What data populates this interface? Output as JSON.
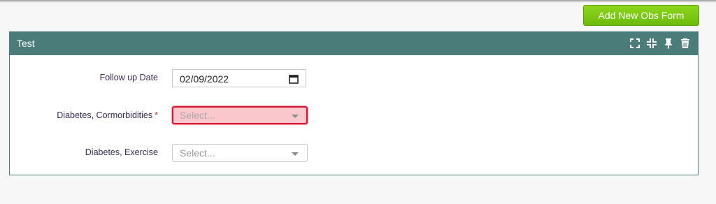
{
  "toolbar": {
    "add_label": "Add New Obs Form"
  },
  "panel": {
    "title": "Test",
    "icons": [
      "expand-icon",
      "compress-icon",
      "pin-icon",
      "trash-icon"
    ]
  },
  "form": {
    "follow_up": {
      "label": "Follow up Date",
      "value": "02/09/2022"
    },
    "cormorbidities": {
      "label": "Diabetes, Cormorbidities",
      "required_mark": "*",
      "placeholder": "Select..."
    },
    "exercise": {
      "label": "Diabetes, Exercise",
      "placeholder": "Select..."
    }
  },
  "colors": {
    "header": "#4a7c7a",
    "accent_green": "#7ac70f",
    "error": "#d8152f",
    "label_text": "#3b2a58"
  }
}
